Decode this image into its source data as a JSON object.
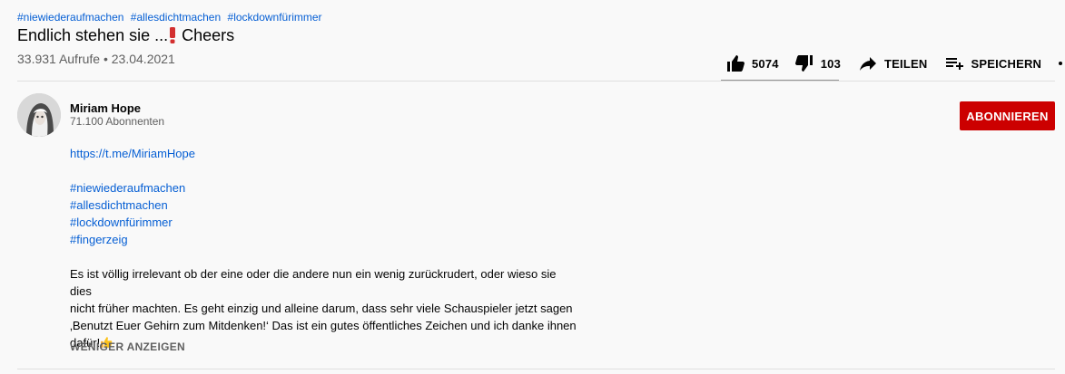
{
  "video": {
    "hashtags": [
      "#niewiederaufmachen",
      "#allesdichtmachen",
      "#lockdownfürimmer"
    ],
    "title_text": "Endlich stehen sie ...",
    "title_suffix": " Cheers",
    "views": "33.931 Aufrufe",
    "separator": " • ",
    "date": "23.04.2021"
  },
  "actions": {
    "likes": "5074",
    "dislikes": "103",
    "share_label": "TEILEN",
    "save_label": "SPEICHERN",
    "like_ratio": 0.98
  },
  "channel": {
    "name": "Miriam Hope",
    "subscribers": "71.100 Abonnenten",
    "subscribe_label": "ABONNIEREN"
  },
  "description": {
    "link": "https://t.me/MiriamHope",
    "tags": [
      "#niewiederaufmachen",
      "#allesdichtmachen",
      "#lockdownfürimmer",
      "#fingerzeig"
    ],
    "body_lines": [
      "Es ist völlig irrelevant ob der eine oder die andere nun ein wenig zurückrudert, oder wieso sie dies",
      "nicht früher machten. Es geht einzig und alleine darum, dass sehr viele Schauspieler jetzt sagen",
      "‚Benutzt Euer Gehirn zum Mitdenken!‘  Das ist ein gutes öffentliches Zeichen und ich danke ihnen",
      "dafür!"
    ],
    "show_less_label": "WENIGER ANZEIGEN"
  },
  "colors": {
    "link": "#065fd4",
    "subscribe_bg": "#cc0000",
    "secondary_text": "#606060"
  },
  "icons": [
    "thumb-up-icon",
    "thumb-down-icon",
    "share-arrow-icon",
    "playlist-add-icon",
    "more-dots-icon",
    "exclamation-emoji-icon",
    "thumbs-up-emoji-icon"
  ]
}
